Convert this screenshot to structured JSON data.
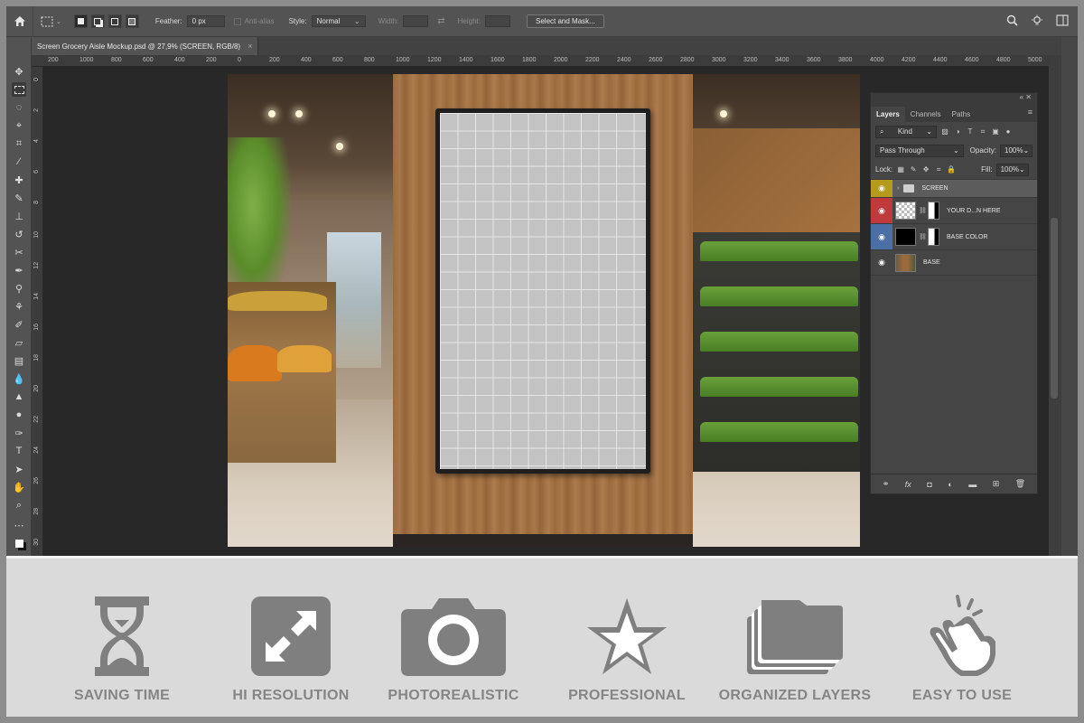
{
  "options_bar": {
    "feather_label": "Feather:",
    "feather_value": "0 px",
    "antialias_label": "Anti-alias",
    "style_label": "Style:",
    "style_value": "Normal",
    "width_label": "Width:",
    "height_label": "Height:",
    "select_mask_label": "Select and Mask..."
  },
  "document_tab": {
    "title": "Screen Grocery Aisle Mockup.psd @ 27,9% (SCREEN, RGB/8)",
    "close": "×"
  },
  "ruler": {
    "horizontal": [
      "200",
      "1000",
      "800",
      "600",
      "400",
      "200",
      "0",
      "200",
      "400",
      "600",
      "800",
      "1000",
      "1200",
      "1400",
      "1600",
      "1800",
      "2000",
      "2200",
      "2400",
      "2600",
      "2800",
      "3000",
      "3200",
      "3400",
      "3600",
      "3800",
      "4000",
      "4200",
      "4400",
      "4600",
      "4800",
      "5000"
    ],
    "vertical": [
      "0",
      "2",
      "4",
      "6",
      "8",
      "10",
      "12",
      "14",
      "16",
      "18",
      "20",
      "22",
      "24",
      "26",
      "28",
      "30"
    ]
  },
  "layers_panel": {
    "tabs": [
      "Layers",
      "Channels",
      "Paths"
    ],
    "active_tab": "Layers",
    "filter_label": "Kind",
    "blend_mode": "Pass Through",
    "opacity_label": "Opacity:",
    "opacity_value": "100%",
    "lock_label": "Lock:",
    "fill_label": "Fill:",
    "fill_value": "100%",
    "layers": [
      {
        "name": "SCREEN",
        "label_color": "#b59a1c",
        "type": "group",
        "selected": true
      },
      {
        "name": "YOUR D...N HERE",
        "label_color": "#c0393b",
        "type": "smart-object"
      },
      {
        "name": "BASE COLOR",
        "label_color": "#4a6fa5",
        "type": "fill"
      },
      {
        "name": "BASE",
        "label_color": "#454545",
        "type": "image"
      }
    ]
  },
  "features": [
    {
      "label": "SAVING TIME",
      "icon": "hourglass-icon"
    },
    {
      "label": "HI RESOLUTION",
      "icon": "expand-icon"
    },
    {
      "label": "PHOTOREALISTIC",
      "icon": "camera-icon"
    },
    {
      "label": "PROFESSIONAL",
      "icon": "star-icon"
    },
    {
      "label": "ORGANIZED LAYERS",
      "icon": "folders-icon"
    },
    {
      "label": "EASY TO USE",
      "icon": "hand-pointer-icon"
    }
  ],
  "colors": {
    "feature_icon": "#7f7f7f",
    "feature_bg": "#dadada",
    "ps_chrome": "#535353"
  }
}
